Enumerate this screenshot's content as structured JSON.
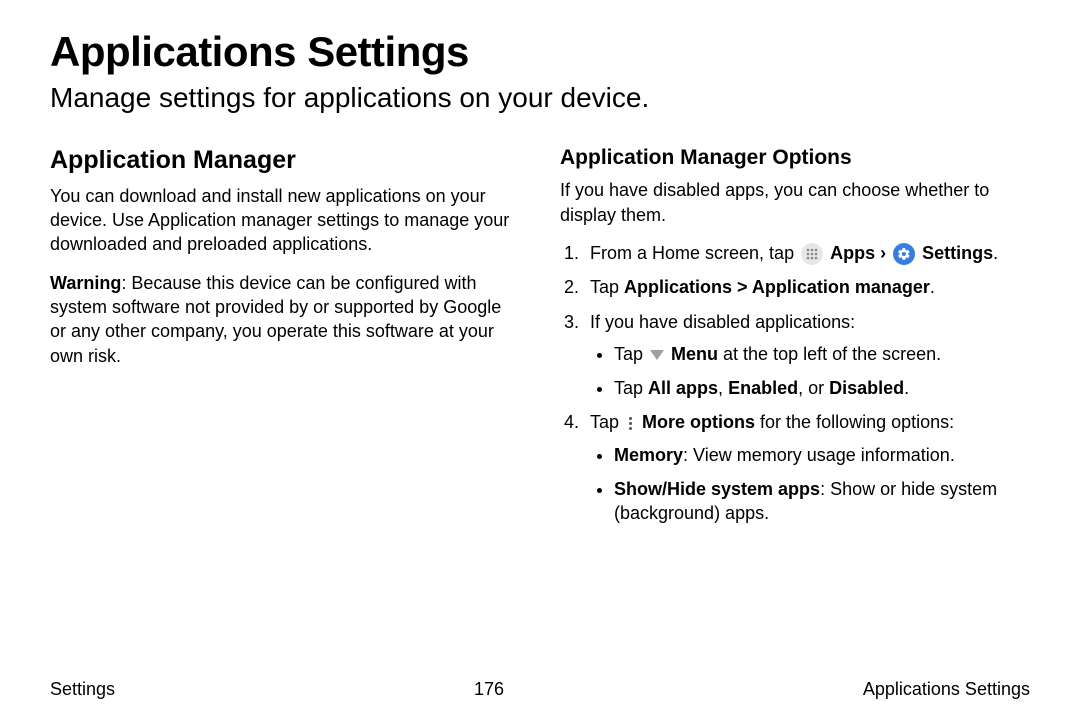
{
  "header": {
    "title": "Applications Settings",
    "subtitle": "Manage settings for applications on your device."
  },
  "left": {
    "heading": "Application Manager",
    "p1": "You can download and install new applications on your device. Use Application manager settings to manage your downloaded and preloaded applications.",
    "warn_label": "Warning",
    "warn_body": ": Because this device can be configured with system software not provided by or supported by Google or any other company, you operate this software at your own risk."
  },
  "right": {
    "heading": "Application Manager Options",
    "intro": "If you have disabled apps, you can choose whether to display them.",
    "step1_pre": "From a Home screen, tap ",
    "apps": " Apps ",
    "chev": "› ",
    "settings_label": " Settings",
    "period": ".",
    "step2_pre": "Tap ",
    "step2_bold": "Applications > Application manager",
    "step3": "If you have disabled applications:",
    "b1_pre": "Tap ",
    "b1_bold": " Menu",
    "b1_post": " at the top left of the screen.",
    "b2_pre": "Tap ",
    "b2_bold": "All apps",
    "b2_sep1": ", ",
    "b2_bold2": "Enabled",
    "b2_sep2": ", or ",
    "b2_bold3": "Disabled",
    "step4_pre": "Tap ",
    "step4_bold": " More options",
    "step4_post": " for the following options:",
    "s1_bold": "Memory",
    "s1_post": ": View memory usage information.",
    "s2_bold": "Show/Hide system apps",
    "s2_post": ": Show or hide system (background) apps."
  },
  "footer": {
    "left": "Settings",
    "page": "176",
    "right": "Applications Settings"
  }
}
